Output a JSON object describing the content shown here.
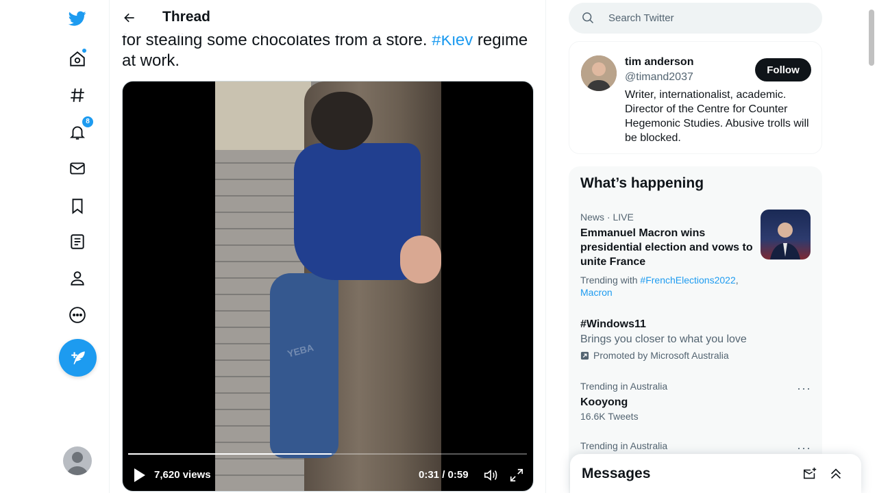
{
  "app": {
    "brand_color": "#1d9bf0"
  },
  "nav": {
    "items": [
      {
        "icon": "twitter-logo-icon"
      },
      {
        "icon": "home-icon",
        "has_dot": true
      },
      {
        "icon": "explore-hashtag-icon"
      },
      {
        "icon": "notifications-bell-icon",
        "badge": "8"
      },
      {
        "icon": "messages-envelope-icon"
      },
      {
        "icon": "bookmarks-icon"
      },
      {
        "icon": "lists-icon"
      },
      {
        "icon": "profile-icon"
      },
      {
        "icon": "more-circle-icon"
      }
    ],
    "compose_icon": "compose-feather-icon"
  },
  "header": {
    "title": "Thread"
  },
  "tweet": {
    "text_before": "for stealing some chocolates from a store. ",
    "hashtag": "#Kiev",
    "text_after": " regime at work."
  },
  "video": {
    "views": "7,620 views",
    "time": "0:31 / 0:59",
    "progress": 0.51,
    "watermark": "YEBA"
  },
  "search": {
    "placeholder": "Search Twitter"
  },
  "profile": {
    "name": "tim anderson",
    "handle": "@timand2037",
    "follow_label": "Follow",
    "bio": "Writer, internationalist, academic. Director of the Centre for Counter Hegemonic Studies. Abusive trolls will be blocked."
  },
  "trends": {
    "title": "What’s happening",
    "items": [
      {
        "meta": "News · LIVE",
        "title": "Emmanuel Macron wins presidential election and vows to unite France",
        "trending_with": "Trending with",
        "link1": "#FrenchElections2022",
        "sep": ",",
        "link2": "Macron"
      },
      {
        "title": "#Windows11",
        "subtitle": "Brings you closer to what you love",
        "promoted": "Promoted by Microsoft Australia"
      },
      {
        "meta": "Trending in Australia",
        "title": "Kooyong",
        "subtitle": "16.6K Tweets"
      },
      {
        "meta": "Trending in Australia"
      }
    ]
  },
  "messages": {
    "title": "Messages"
  }
}
